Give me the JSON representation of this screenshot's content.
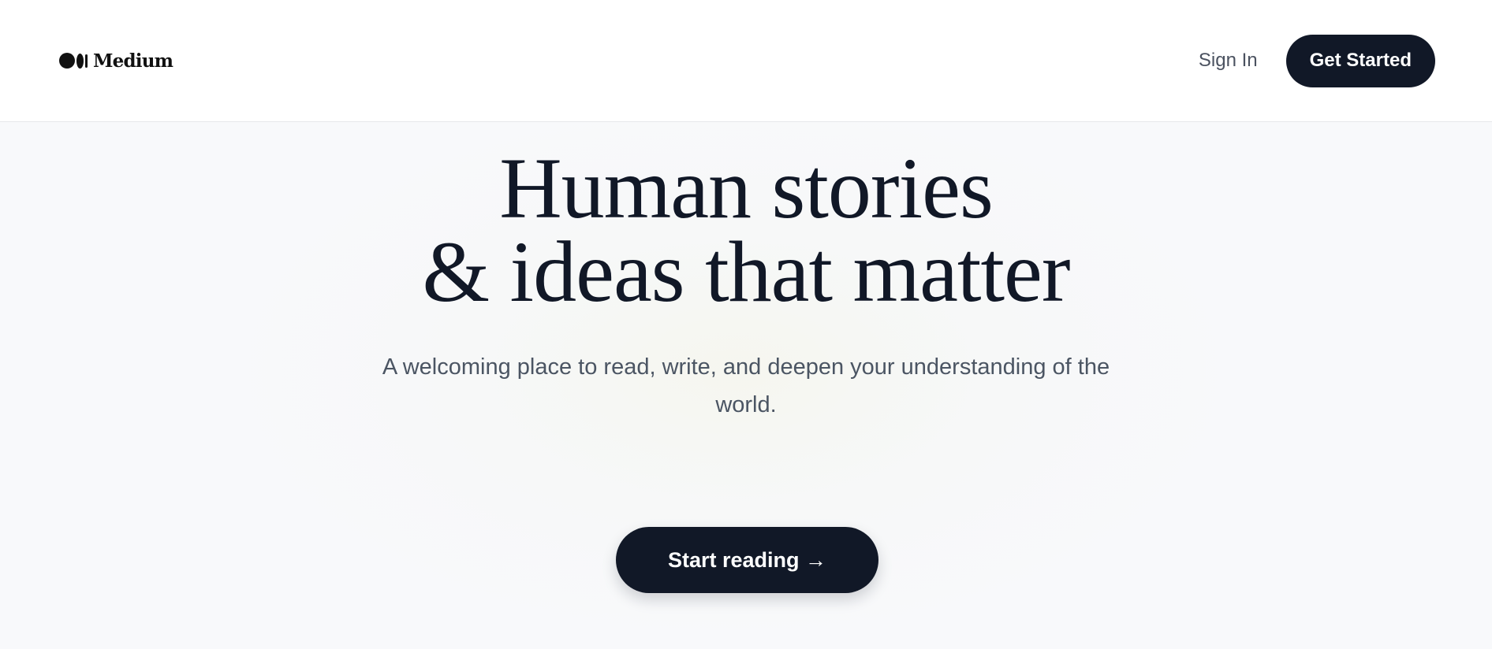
{
  "header": {
    "logo_text": "Medium",
    "logo_icon": "medium-logo-icon",
    "sign_in_label": "Sign In",
    "get_started_label": "Get Started"
  },
  "hero": {
    "headline_line1": "Human stories",
    "headline_line2": "& ideas that matter",
    "subtitle": "A welcoming place to read, write, and deepen your understanding of the world.",
    "cta_label": "Start reading →"
  },
  "colors": {
    "primary_dark": "#111827",
    "background": "#f8f9fb",
    "header_background": "#ffffff",
    "muted_text": "#4b5563"
  }
}
